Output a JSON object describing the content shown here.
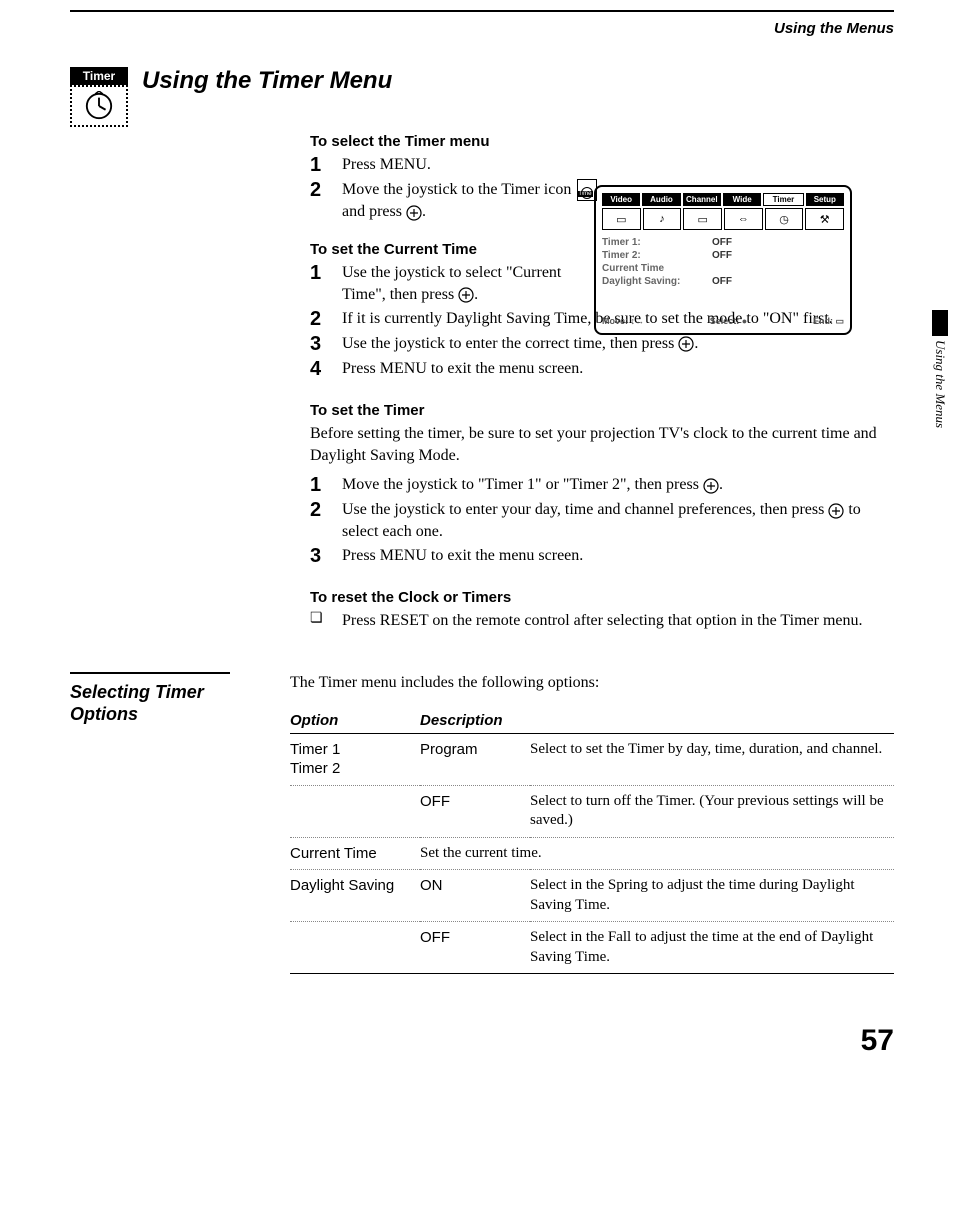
{
  "header": {
    "running": "Using the Menus"
  },
  "side_tab": "Using the Menus",
  "badge": {
    "label": "Timer"
  },
  "title": "Using the Timer Menu",
  "h_select": "To select the Timer menu",
  "steps_select": {
    "s1": "Press MENU.",
    "s2a": "Move the joystick to the Timer icon ",
    "s2b": " and press "
  },
  "h_current": "To set the Current Time",
  "steps_current": {
    "s1": "Use the joystick to select \"Current Time\", then press ",
    "s2": "If it is currently Daylight Saving Time, be sure to set the mode to \"ON\" first.",
    "s3": "Use the joystick to enter the correct time, then press ",
    "s4": "Press MENU to exit the menu screen."
  },
  "h_timer": "To set the Timer",
  "timer_intro": "Before setting the timer, be sure to set your projection TV's clock to the current time and Daylight Saving Mode.",
  "steps_timer": {
    "s1": "Move the joystick to \"Timer 1\" or \"Timer 2\", then press ",
    "s2a": "Use the joystick to enter your day, time and channel preferences, then press ",
    "s2b": " to select each one.",
    "s3": "Press MENU to exit the menu screen."
  },
  "h_reset": "To reset the Clock or Timers",
  "reset_text": "Press RESET on the remote control after selecting that option in the Timer menu.",
  "section2": {
    "heading": "Selecting Timer Options",
    "intro": "The Timer menu includes the following options:"
  },
  "table": {
    "h_option": "Option",
    "h_desc": "Description",
    "rows": [
      {
        "option": "Timer 1\nTimer 2",
        "value": "Program",
        "desc": "Select to set the Timer by day, time, duration, and channel."
      },
      {
        "option": "",
        "value": "OFF",
        "desc": "Select to turn off the Timer. (Your previous settings will be saved.)"
      },
      {
        "option": "Current Time",
        "value": "Set the current time.",
        "desc": "",
        "span": true
      },
      {
        "option": "Daylight Saving",
        "value": "ON",
        "desc": "Select in the Spring to adjust the time during Daylight Saving Time."
      },
      {
        "option": "",
        "value": "OFF",
        "desc": "Select in the Fall to adjust the time at the end of Daylight Saving Time."
      }
    ]
  },
  "osd": {
    "tabs": [
      "Video",
      "Audio",
      "Channel",
      "Wide",
      "Timer",
      "Setup"
    ],
    "selected_tab_index": 4,
    "lines": [
      {
        "k": "Timer 1:",
        "v": "OFF"
      },
      {
        "k": "Timer 2:",
        "v": "OFF"
      },
      {
        "k": "Current Time",
        "v": ""
      },
      {
        "k": "Daylight Saving:",
        "v": "OFF"
      }
    ],
    "footer": {
      "move": "Move: ↕↔",
      "select": "Select: ●",
      "end": "End: ▭"
    }
  },
  "page_number": "57"
}
